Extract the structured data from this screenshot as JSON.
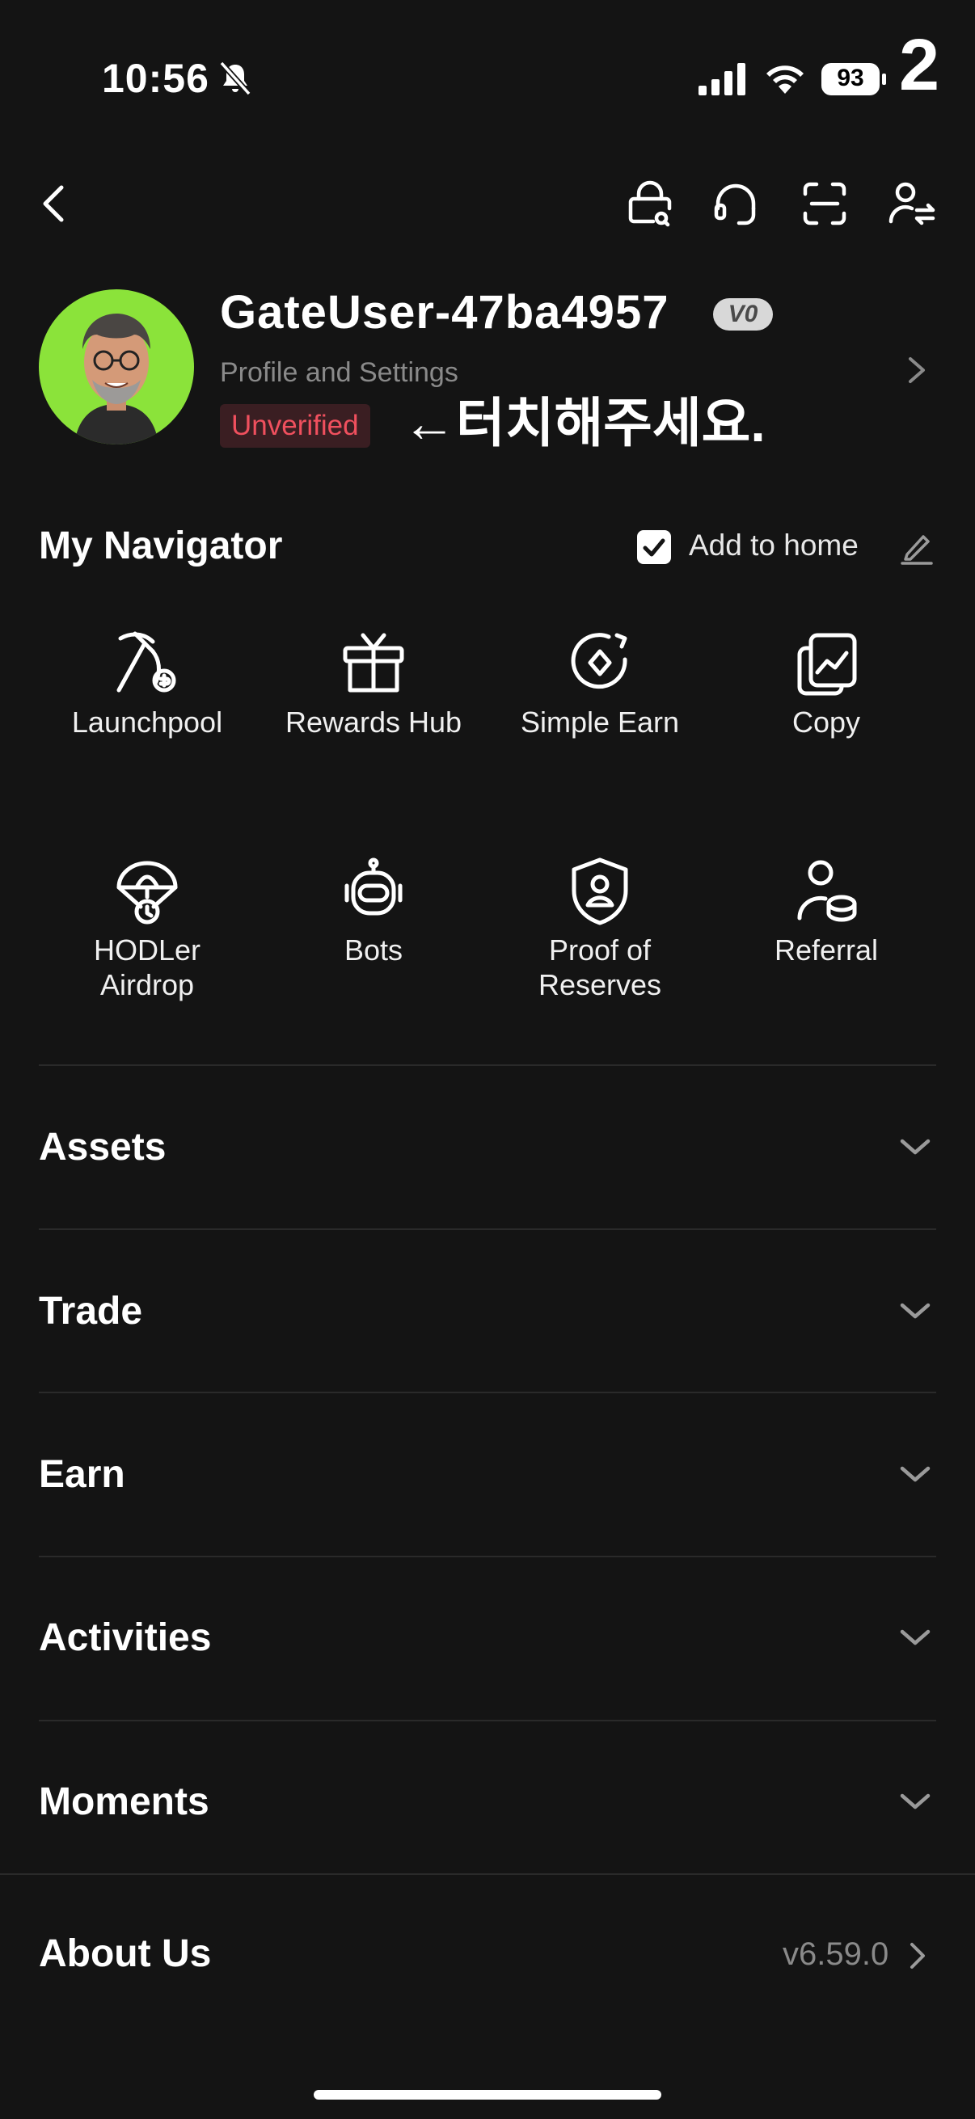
{
  "status_bar": {
    "time": "10:56",
    "battery": "93",
    "corner_label": "2"
  },
  "top_icons": [
    "lock-gift-icon",
    "headset-icon",
    "scan-icon",
    "switch-account-icon"
  ],
  "profile": {
    "username": "GateUser-47ba4957",
    "vip_badge": "V0",
    "subtitle": "Profile and Settings",
    "verification_status": "Unverified",
    "annotation": "←터치해주세요."
  },
  "navigator": {
    "title": "My Navigator",
    "add_to_home_label": "Add to home",
    "add_to_home_checked": true,
    "items": [
      {
        "label": "Launchpool",
        "icon": "pickaxe-icon"
      },
      {
        "label": "Rewards Hub",
        "icon": "gift-icon"
      },
      {
        "label": "Simple Earn",
        "icon": "coin-earn-icon"
      },
      {
        "label": "Copy",
        "icon": "copy-trade-icon"
      },
      {
        "label": "HODLer\nAirdrop",
        "label_line1": "HODLer",
        "label_line2": "Airdrop",
        "icon": "parachute-icon"
      },
      {
        "label": "Bots",
        "icon": "robot-icon"
      },
      {
        "label_line1": "Proof of",
        "label_line2": "Reserves",
        "icon": "shield-user-icon"
      },
      {
        "label": "Referral",
        "icon": "referral-icon"
      }
    ]
  },
  "sections": [
    "Assets",
    "Trade",
    "Earn",
    "Activities",
    "Moments"
  ],
  "about": {
    "label": "About Us",
    "version": "v6.59.0"
  },
  "colors": {
    "background": "#141414",
    "unverified": "#f0505e",
    "avatar_bg": "#8be33a"
  }
}
